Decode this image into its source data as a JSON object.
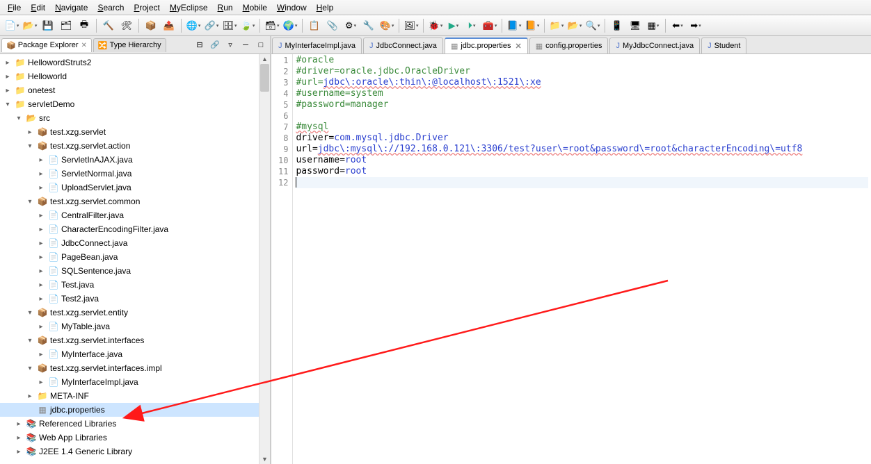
{
  "menu": [
    "File",
    "Edit",
    "Navigate",
    "Search",
    "Project",
    "MyEclipse",
    "Run",
    "Mobile",
    "Window",
    "Help"
  ],
  "sidebar": {
    "tabs": [
      {
        "label": "Package Explorer",
        "icon": "📦",
        "active": true
      },
      {
        "label": "Type Hierarchy",
        "icon": "🔀",
        "active": false
      }
    ],
    "tree": [
      {
        "d": 0,
        "tw": "col",
        "icon": "📁",
        "cls": "ti-proj",
        "label": "HellowordStruts2"
      },
      {
        "d": 0,
        "tw": "col",
        "icon": "📁",
        "cls": "ti-proj",
        "label": "Helloworld"
      },
      {
        "d": 0,
        "tw": "col",
        "icon": "📁",
        "cls": "ti-proj",
        "label": "onetest"
      },
      {
        "d": 0,
        "tw": "exp",
        "icon": "📁",
        "cls": "ti-proj",
        "label": "servletDemo"
      },
      {
        "d": 1,
        "tw": "exp",
        "icon": "📂",
        "cls": "ti-src",
        "label": "src"
      },
      {
        "d": 2,
        "tw": "col",
        "icon": "📦",
        "cls": "ti-pkg",
        "label": "test.xzg.servlet"
      },
      {
        "d": 2,
        "tw": "exp",
        "icon": "📦",
        "cls": "ti-pkg",
        "label": "test.xzg.servlet.action"
      },
      {
        "d": 3,
        "tw": "col",
        "icon": "📄",
        "cls": "ti-java",
        "label": "ServletInAJAX.java"
      },
      {
        "d": 3,
        "tw": "col",
        "icon": "📄",
        "cls": "ti-java",
        "label": "ServletNormal.java"
      },
      {
        "d": 3,
        "tw": "col",
        "icon": "📄",
        "cls": "ti-java",
        "label": "UploadServlet.java"
      },
      {
        "d": 2,
        "tw": "exp",
        "icon": "📦",
        "cls": "ti-pkg",
        "label": "test.xzg.servlet.common"
      },
      {
        "d": 3,
        "tw": "col",
        "icon": "📄",
        "cls": "ti-java",
        "label": "CentralFilter.java"
      },
      {
        "d": 3,
        "tw": "col",
        "icon": "📄",
        "cls": "ti-java",
        "label": "CharacterEncodingFilter.java"
      },
      {
        "d": 3,
        "tw": "col",
        "icon": "📄",
        "cls": "ti-java",
        "label": "JdbcConnect.java"
      },
      {
        "d": 3,
        "tw": "col",
        "icon": "📄",
        "cls": "ti-java",
        "label": "PageBean.java"
      },
      {
        "d": 3,
        "tw": "col",
        "icon": "📄",
        "cls": "ti-java",
        "label": "SQLSentence.java"
      },
      {
        "d": 3,
        "tw": "col",
        "icon": "📄",
        "cls": "ti-java",
        "label": "Test.java"
      },
      {
        "d": 3,
        "tw": "col",
        "icon": "📄",
        "cls": "ti-java",
        "label": "Test2.java"
      },
      {
        "d": 2,
        "tw": "exp",
        "icon": "📦",
        "cls": "ti-pkg",
        "label": "test.xzg.servlet.entity"
      },
      {
        "d": 3,
        "tw": "col",
        "icon": "📄",
        "cls": "ti-java",
        "label": "MyTable.java"
      },
      {
        "d": 2,
        "tw": "exp",
        "icon": "📦",
        "cls": "ti-pkg",
        "label": "test.xzg.servlet.interfaces"
      },
      {
        "d": 3,
        "tw": "col",
        "icon": "📄",
        "cls": "ti-java",
        "label": "MyInterface.java"
      },
      {
        "d": 2,
        "tw": "exp",
        "icon": "📦",
        "cls": "ti-pkg",
        "label": "test.xzg.servlet.interfaces.impl"
      },
      {
        "d": 3,
        "tw": "col",
        "icon": "📄",
        "cls": "ti-java",
        "label": "MyInterfaceImpl.java"
      },
      {
        "d": 2,
        "tw": "col",
        "icon": "📁",
        "cls": "ti-folder",
        "label": "META-INF"
      },
      {
        "d": 2,
        "tw": "none",
        "icon": "▦",
        "cls": "ti-prop",
        "label": "jdbc.properties",
        "selected": true
      },
      {
        "d": 1,
        "tw": "col",
        "icon": "📚",
        "cls": "ti-lib",
        "label": "Referenced Libraries"
      },
      {
        "d": 1,
        "tw": "col",
        "icon": "📚",
        "cls": "ti-lib",
        "label": "Web App Libraries"
      },
      {
        "d": 1,
        "tw": "col",
        "icon": "📚",
        "cls": "ti-lib",
        "label": "J2EE 1.4 Generic Library"
      }
    ]
  },
  "editor": {
    "tabs": [
      {
        "label": "MyInterfaceImpl.java",
        "icon": "J",
        "active": false
      },
      {
        "label": "JdbcConnect.java",
        "icon": "J",
        "active": false
      },
      {
        "label": "jdbc.properties",
        "icon": "▦",
        "active": true
      },
      {
        "label": "config.properties",
        "icon": "▦",
        "active": false
      },
      {
        "label": "MyJdbcConnect.java",
        "icon": "J",
        "active": false
      },
      {
        "label": "Student",
        "icon": "J",
        "active": false
      }
    ],
    "lines": [
      {
        "n": 1,
        "type": "comment",
        "text": "#oracle"
      },
      {
        "n": 2,
        "type": "comment",
        "text": "#driver=oracle.jdbc.OracleDriver"
      },
      {
        "n": 3,
        "type": "comment-url",
        "prefix": "#url=",
        "url": "jdbc\\:oracle\\:thin\\:@localhost\\:1521\\:xe"
      },
      {
        "n": 4,
        "type": "comment",
        "text": "#username=system"
      },
      {
        "n": 5,
        "type": "comment",
        "text": "#password=manager"
      },
      {
        "n": 6,
        "type": "blank",
        "text": ""
      },
      {
        "n": 7,
        "type": "comment-underline",
        "text": "#mysql"
      },
      {
        "n": 8,
        "type": "kv",
        "key": "driver",
        "val": "com.mysql.jdbc.Driver"
      },
      {
        "n": 9,
        "type": "kv-url",
        "key": "url",
        "url": "jdbc\\:mysql\\://192.168.0.121\\:3306/test?user\\=root&password\\=root&characterEncoding\\=utf8"
      },
      {
        "n": 10,
        "type": "kv",
        "key": "username",
        "val": "root"
      },
      {
        "n": 11,
        "type": "kv",
        "key": "password",
        "val": "root"
      },
      {
        "n": 12,
        "type": "cursor",
        "text": ""
      }
    ]
  }
}
